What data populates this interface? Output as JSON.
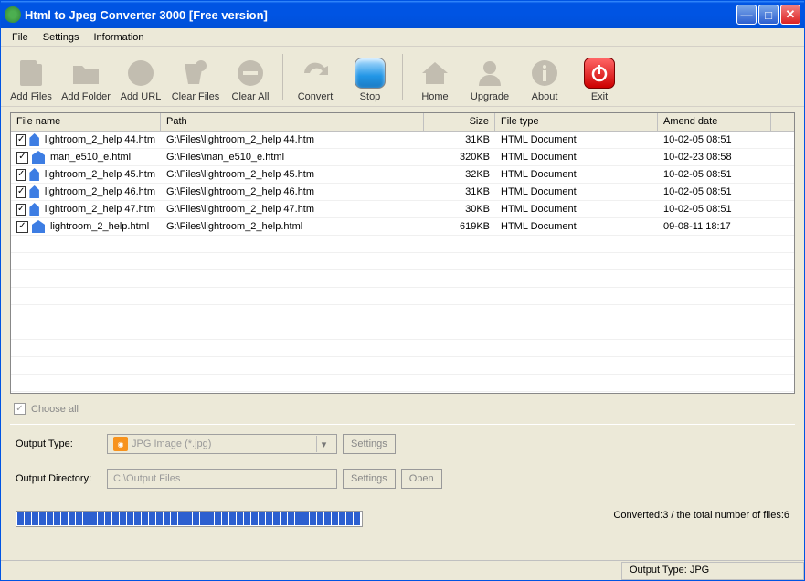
{
  "window": {
    "title": "Html to Jpeg Converter 3000 [Free version]"
  },
  "menu": {
    "file": "File",
    "settings": "Settings",
    "information": "Information"
  },
  "toolbar": {
    "add_files": "Add Files",
    "add_folder": "Add Folder",
    "add_url": "Add URL",
    "clear_files": "Clear Files",
    "clear_all": "Clear All",
    "convert": "Convert",
    "stop": "Stop",
    "home": "Home",
    "upgrade": "Upgrade",
    "about": "About",
    "exit": "Exit"
  },
  "columns": {
    "name": "File name",
    "path": "Path",
    "size": "Size",
    "type": "File type",
    "date": "Amend date"
  },
  "rows": [
    {
      "checked": true,
      "name": "lightroom_2_help 44.htm",
      "path": "G:\\Files\\lightroom_2_help 44.htm",
      "size": "31KB",
      "type": "HTML Document",
      "date": "10-02-05 08:51"
    },
    {
      "checked": true,
      "name": "man_e510_e.html",
      "path": "G:\\Files\\man_e510_e.html",
      "size": "320KB",
      "type": "HTML Document",
      "date": "10-02-23 08:58"
    },
    {
      "checked": true,
      "name": "lightroom_2_help 45.htm",
      "path": "G:\\Files\\lightroom_2_help 45.htm",
      "size": "32KB",
      "type": "HTML Document",
      "date": "10-02-05 08:51"
    },
    {
      "checked": true,
      "name": "lightroom_2_help 46.htm",
      "path": "G:\\Files\\lightroom_2_help 46.htm",
      "size": "31KB",
      "type": "HTML Document",
      "date": "10-02-05 08:51"
    },
    {
      "checked": true,
      "name": "lightroom_2_help 47.htm",
      "path": "G:\\Files\\lightroom_2_help 47.htm",
      "size": "30KB",
      "type": "HTML Document",
      "date": "10-02-05 08:51"
    },
    {
      "checked": true,
      "name": "lightroom_2_help.html",
      "path": "G:\\Files\\lightroom_2_help.html",
      "size": "619KB",
      "type": "HTML Document",
      "date": "09-08-11 18:17"
    }
  ],
  "choose_all": "Choose all",
  "output": {
    "type_label": "Output Type:",
    "type_value": "JPG Image (*.jpg)",
    "settings_btn": "Settings",
    "dir_label": "Output Directory:",
    "dir_value": "C:\\Output Files",
    "open_btn": "Open"
  },
  "progress": {
    "text": "Converted:3  /  the total number of files:6"
  },
  "status": {
    "output_type": "Output Type: JPG"
  }
}
